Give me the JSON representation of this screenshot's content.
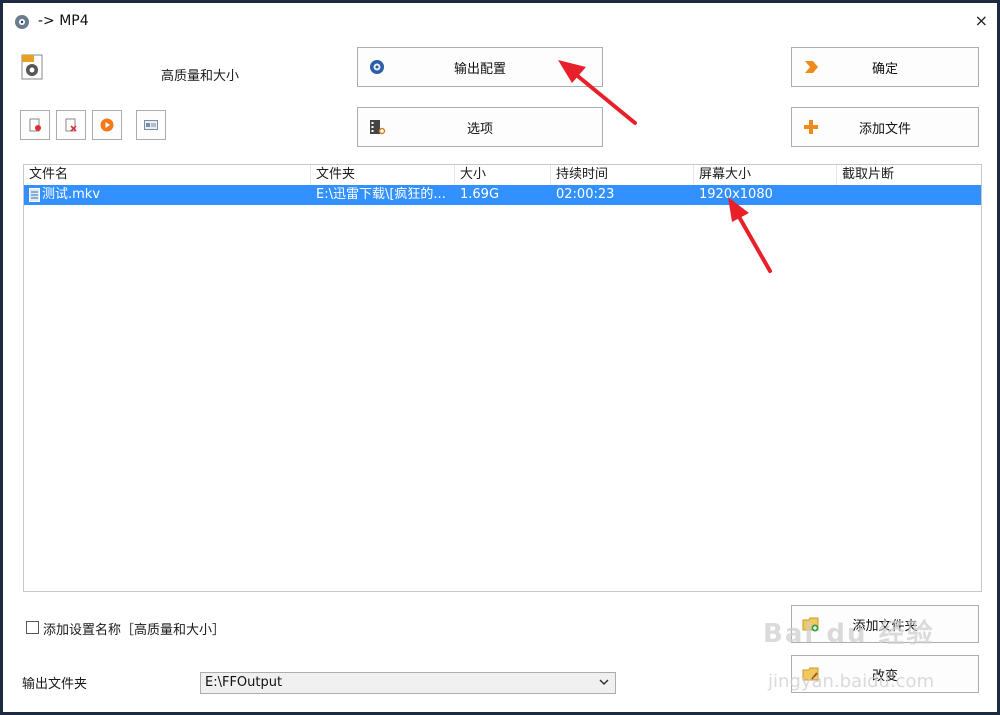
{
  "window": {
    "title": "-> MP4",
    "close_symbol": "×"
  },
  "preset": {
    "label": "高质量和大小"
  },
  "buttons": {
    "output_config": "输出配置",
    "options": "选项",
    "ok": "确定",
    "add_file": "添加文件",
    "add_folder": "添加文件夹",
    "change": "改变"
  },
  "file_list": {
    "columns": [
      "文件名",
      "文件夹",
      "大小",
      "持续时间",
      "屏幕大小",
      "截取片断"
    ],
    "rows": [
      {
        "name": "测试.mkv",
        "folder": "E:\\迅雷下载\\[疯狂的...",
        "size": "1.69G",
        "duration": "02:00:23",
        "screen": "1920x1080",
        "clip": ""
      }
    ]
  },
  "add_setting_name": {
    "label": "添加设置名称［高质量和大小］",
    "checked": false
  },
  "output_folder": {
    "label": "输出文件夹",
    "value": "E:\\FFOutput"
  },
  "watermark": {
    "main": "Bai du 经验",
    "sub": "jingyan.baidu.com"
  },
  "colors": {
    "selection": "#3390ff",
    "annotation_arrow": "#e8202a",
    "frame": "#1c2b3f"
  }
}
